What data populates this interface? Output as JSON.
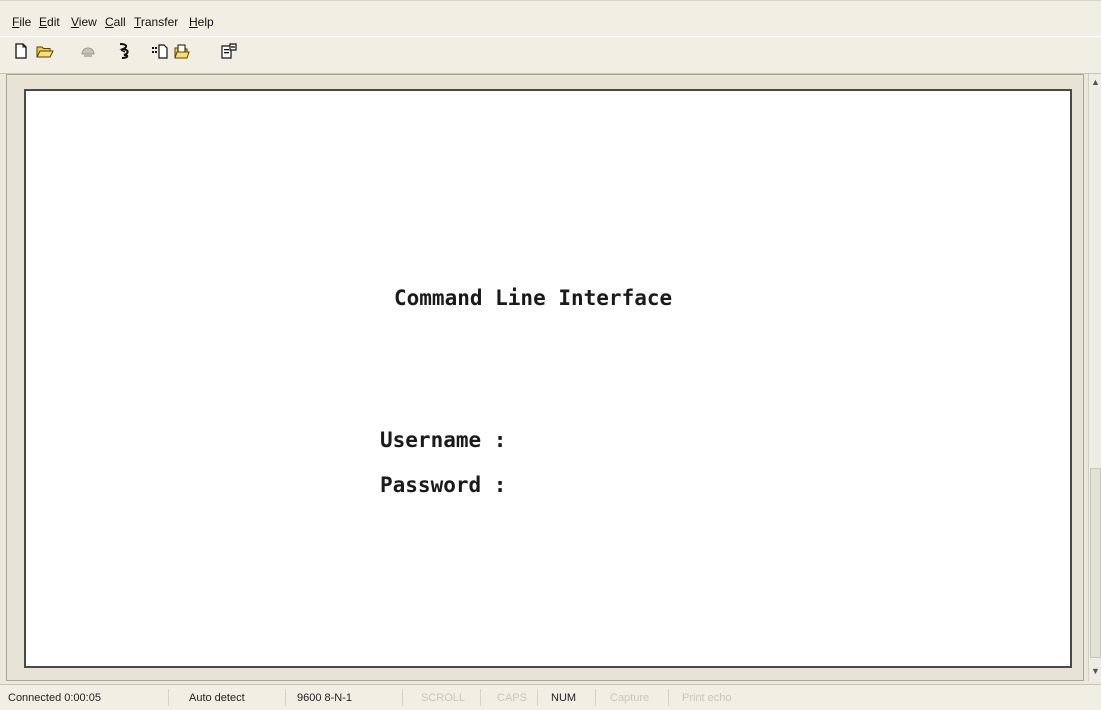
{
  "menu": {
    "file": {
      "mnemonic": "F",
      "rest": "ile"
    },
    "edit": {
      "mnemonic": "E",
      "rest": "dit"
    },
    "view": {
      "mnemonic": "V",
      "rest": "iew"
    },
    "call": {
      "mnemonic": "C",
      "rest": "all"
    },
    "transfer": {
      "mnemonic": "T",
      "rest": "ransfer"
    },
    "help": {
      "mnemonic": "H",
      "rest": "elp"
    }
  },
  "toolbar": {
    "icons": [
      "new-file-icon",
      "open-folder-icon",
      "connect-icon",
      "disconnect-icon",
      "send-file-icon",
      "receive-file-icon",
      "properties-icon"
    ]
  },
  "terminal": {
    "title": "Command Line Interface",
    "username_prompt": "Username :",
    "password_prompt": "Password :"
  },
  "status": {
    "connected": "Connected 0:00:05",
    "auto_detect": "Auto detect",
    "port_settings": "9600 8-N-1",
    "scroll": "SCROLL",
    "caps": "CAPS",
    "num": "NUM",
    "capture": "Capture",
    "print_echo": "Print echo"
  },
  "colors": {
    "window_bg": "#ece9d8",
    "terminal_bg": "#ffffff",
    "terminal_text": "#1a1a1a",
    "disabled_text": "#c9c6bb"
  }
}
